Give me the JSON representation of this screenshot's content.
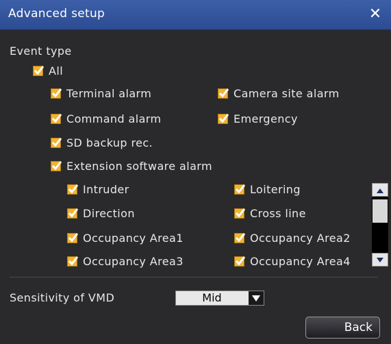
{
  "window": {
    "title": "Advanced setup",
    "close_glyph": "✕"
  },
  "event_type": {
    "label": "Event type",
    "all": {
      "label": "All",
      "checked": true
    },
    "items": [
      {
        "label": "Terminal alarm",
        "checked": true
      },
      {
        "label": "Camera site alarm",
        "checked": true
      },
      {
        "label": "Command alarm",
        "checked": true
      },
      {
        "label": "Emergency",
        "checked": true
      },
      {
        "label": "SD backup rec.",
        "checked": true
      },
      {
        "label": "Extension software alarm",
        "checked": true
      }
    ],
    "extension_items": [
      {
        "label": "Intruder",
        "checked": true
      },
      {
        "label": "Loitering",
        "checked": true
      },
      {
        "label": "Direction",
        "checked": true
      },
      {
        "label": "Cross line",
        "checked": true
      },
      {
        "label": "Occupancy Area1",
        "checked": true
      },
      {
        "label": "Occupancy Area2",
        "checked": true
      },
      {
        "label": "Occupancy Area3",
        "checked": true
      },
      {
        "label": "Occupancy Area4",
        "checked": true
      }
    ]
  },
  "sensitivity": {
    "label": "Sensitivity of VMD",
    "value": "Mid"
  },
  "back_button": {
    "label": "Back"
  },
  "colors": {
    "titlebar": "#3c5fa8",
    "checkbox": "#f2b234",
    "background": "#2a2a2c"
  }
}
